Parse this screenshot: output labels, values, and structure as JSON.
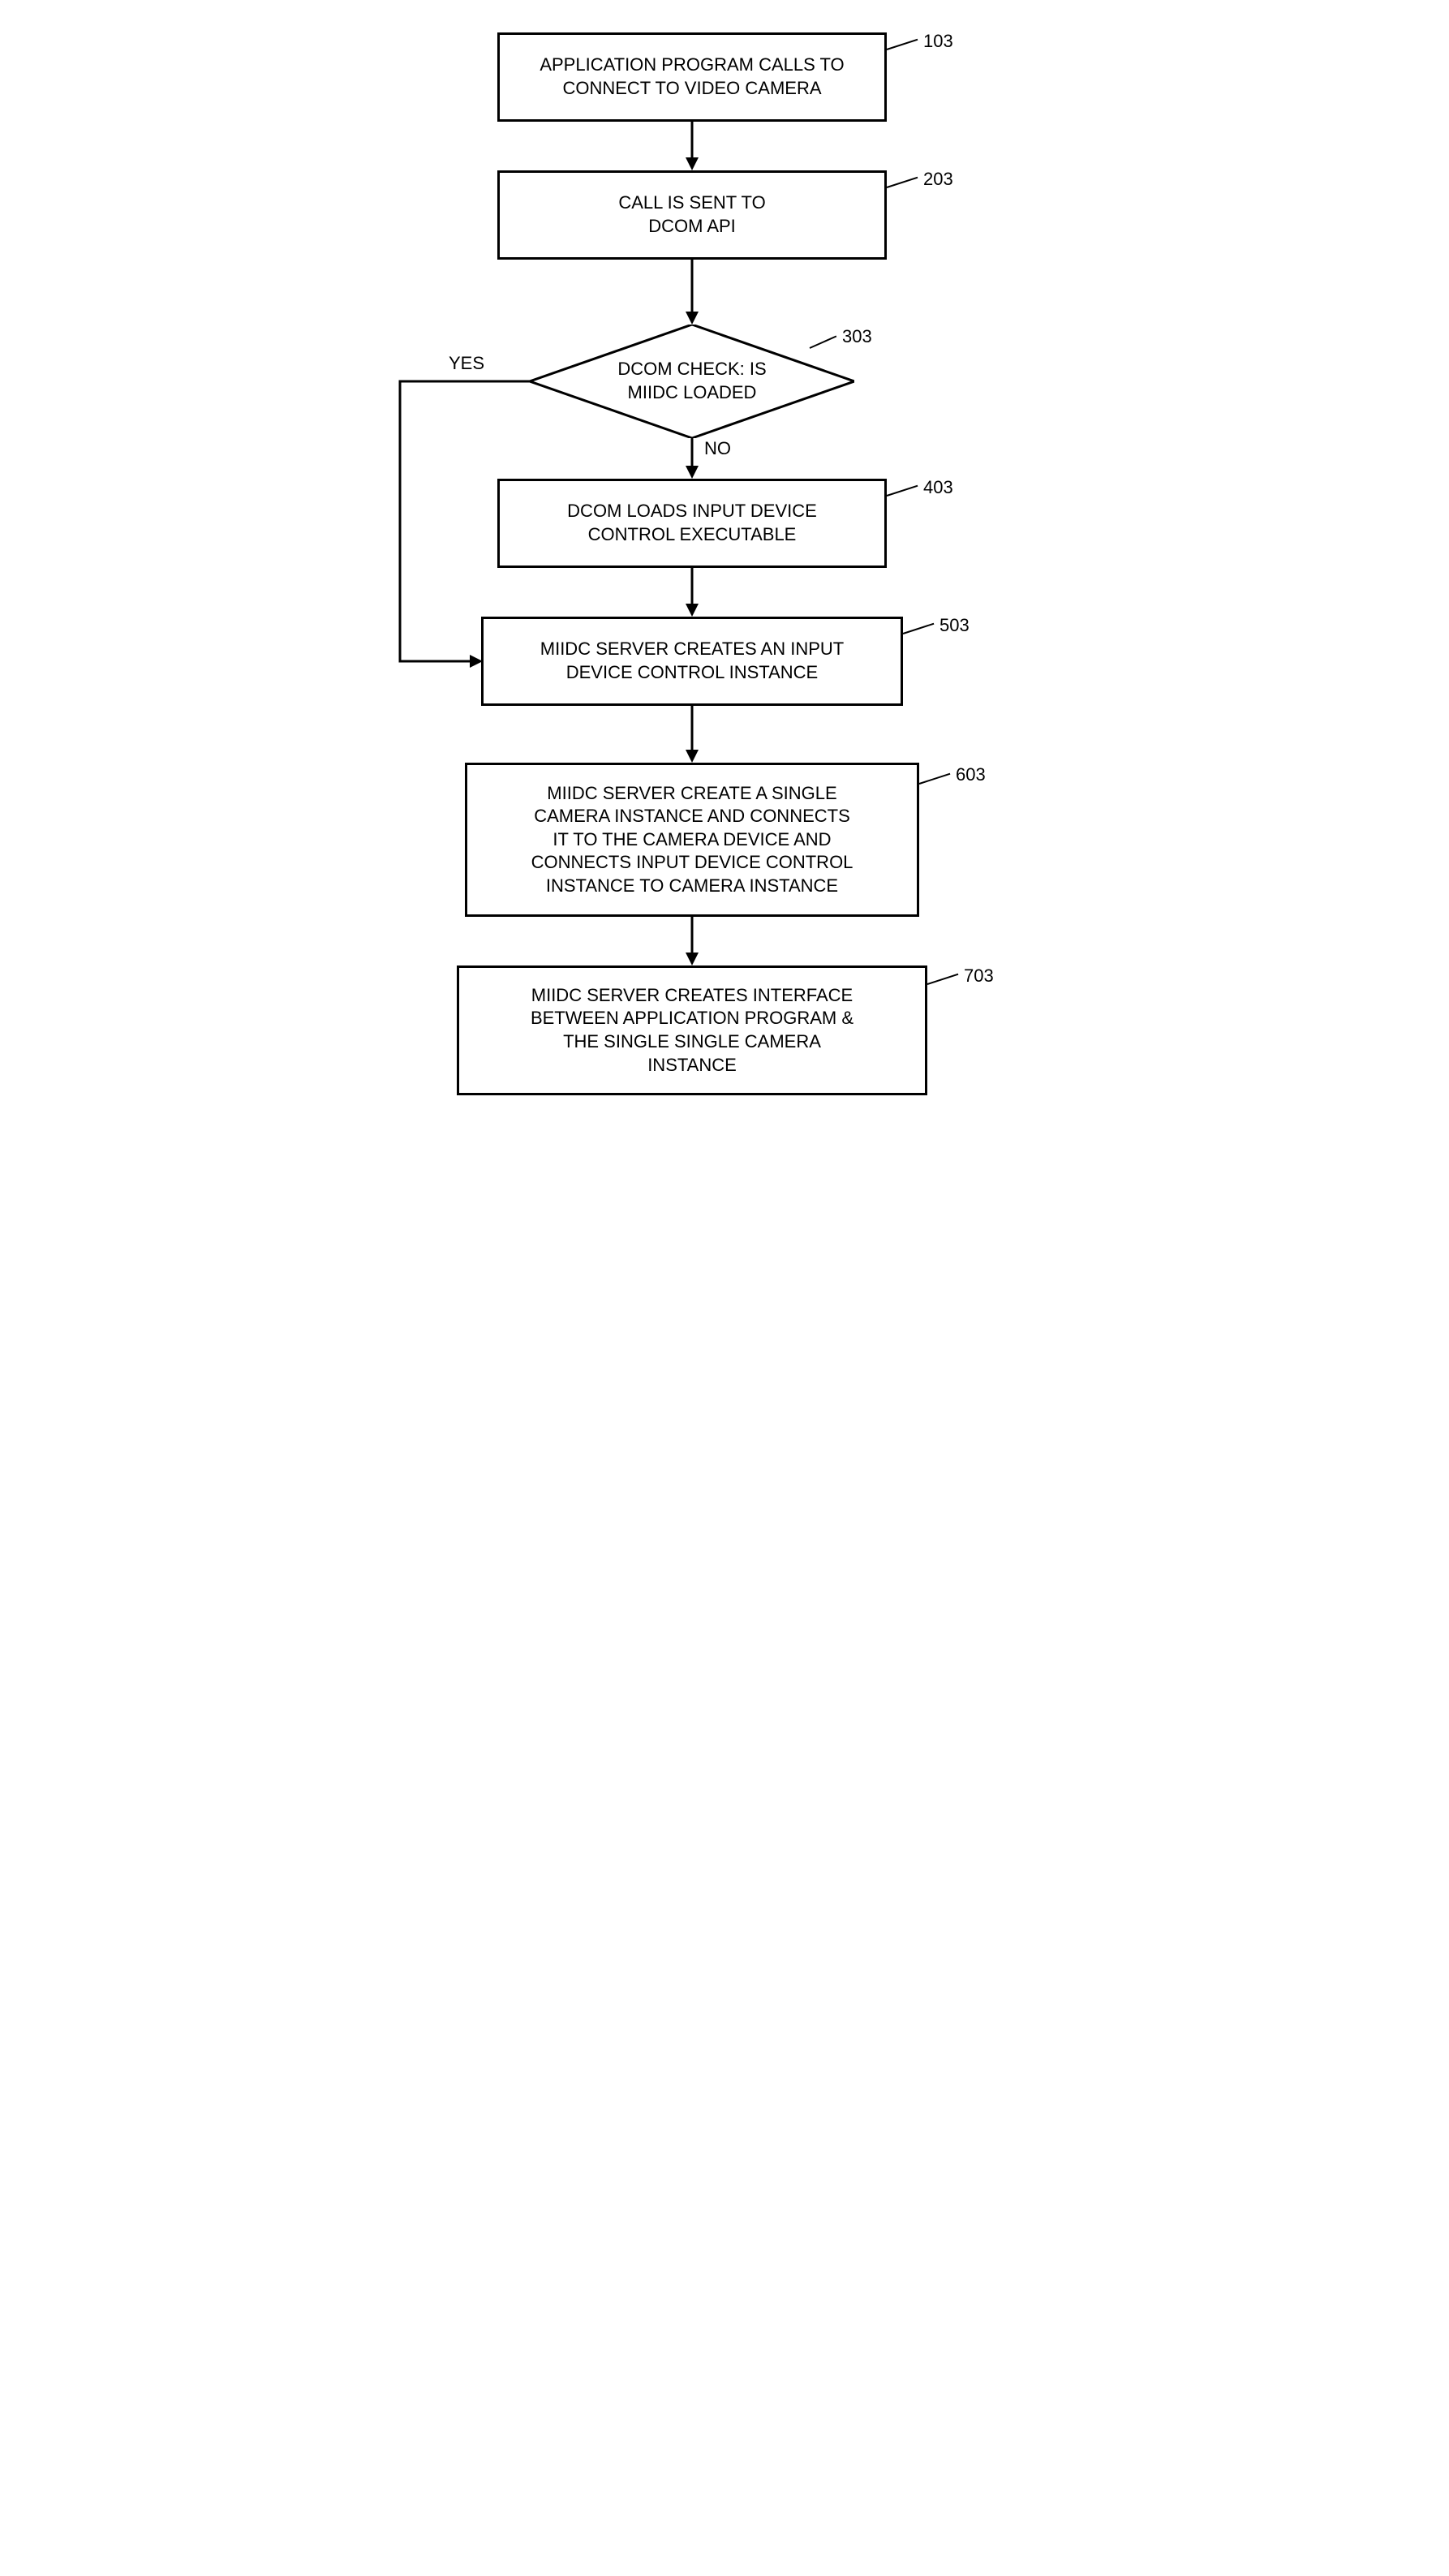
{
  "chart_data": {
    "type": "flowchart",
    "nodes": [
      {
        "id": "103",
        "type": "process",
        "text": "APPLICATION PROGRAM CALLS TO CONNECT TO VIDEO CAMERA"
      },
      {
        "id": "203",
        "type": "process",
        "text": "CALL IS SENT TO DCOM API"
      },
      {
        "id": "303",
        "type": "decision",
        "text": "DCOM CHECK: IS MIIDC LOADED"
      },
      {
        "id": "403",
        "type": "process",
        "text": "DCOM LOADS INPUT DEVICE CONTROL EXECUTABLE"
      },
      {
        "id": "503",
        "type": "process",
        "text": "MIIDC SERVER CREATES AN INPUT DEVICE CONTROL INSTANCE"
      },
      {
        "id": "603",
        "type": "process",
        "text": "MIIDC SERVER CREATE A SINGLE CAMERA INSTANCE AND CONNECTS IT TO THE CAMERA DEVICE AND CONNECTS INPUT DEVICE CONTROL INSTANCE TO CAMERA INSTANCE"
      },
      {
        "id": "703",
        "type": "process",
        "text": "MIIDC SERVER CREATES INTERFACE BETWEEN APPLICATION PROGRAM & THE SINGLE SINGLE CAMERA INSTANCE"
      }
    ],
    "edges": [
      {
        "from": "103",
        "to": "203"
      },
      {
        "from": "203",
        "to": "303"
      },
      {
        "from": "303",
        "to": "403",
        "label": "NO"
      },
      {
        "from": "303",
        "to": "503",
        "label": "YES"
      },
      {
        "from": "403",
        "to": "503"
      },
      {
        "from": "503",
        "to": "603"
      },
      {
        "from": "603",
        "to": "703"
      }
    ]
  },
  "nodes": {
    "n103": "APPLICATION PROGRAM CALLS TO\nCONNECT TO VIDEO CAMERA",
    "n203": "CALL IS SENT TO\nDCOM API",
    "n303": "DCOM CHECK: IS\nMIIDC LOADED",
    "n403": "DCOM LOADS INPUT DEVICE\nCONTROL EXECUTABLE",
    "n503": "MIIDC SERVER CREATES AN INPUT\nDEVICE CONTROL INSTANCE",
    "n603": "MIIDC SERVER CREATE A SINGLE\nCAMERA INSTANCE AND CONNECTS\nIT TO THE CAMERA DEVICE AND\nCONNECTS INPUT DEVICE CONTROL\nINSTANCE TO CAMERA INSTANCE",
    "n703": "MIIDC SERVER CREATES INTERFACE\nBETWEEN APPLICATION PROGRAM &\nTHE SINGLE SINGLE CAMERA\nINSTANCE"
  },
  "refs": {
    "r103": "103",
    "r203": "203",
    "r303": "303",
    "r403": "403",
    "r503": "503",
    "r603": "603",
    "r703": "703"
  },
  "labels": {
    "yes": "YES",
    "no": "NO"
  }
}
